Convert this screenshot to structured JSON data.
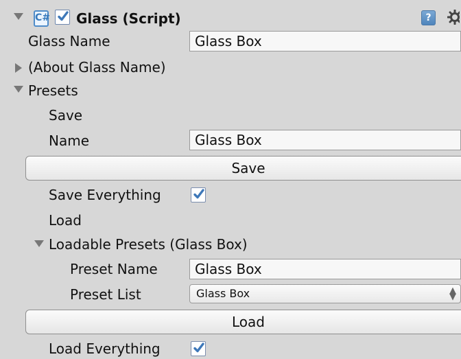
{
  "component": {
    "title": "Glass (Script)",
    "icons": {
      "script": "script-icon",
      "enabled": "checkbox-checked-icon",
      "help": "help-icon",
      "settings": "gear-icon"
    },
    "script_icon_text": "C#",
    "help_icon_text": "?"
  },
  "fields": {
    "glass_name_label": "Glass Name",
    "glass_name_value": "Glass Box",
    "about_glass_name_label": "(About Glass Name)"
  },
  "presets": {
    "label": "Presets",
    "save_section_label": "Save",
    "name_label": "Name",
    "name_value": "Glass Box",
    "save_button": "Save",
    "save_everything_label": "Save Everything",
    "save_everything_checked": true,
    "load_section_label": "Load",
    "loadable_presets_label": "Loadable Presets (Glass Box)",
    "preset_name_label": "Preset Name",
    "preset_name_value": "Glass Box",
    "preset_list_label": "Preset List",
    "preset_list_value": "Glass Box",
    "load_button": "Load",
    "load_everything_label": "Load Everything",
    "load_everything_checked": true
  },
  "colors": {
    "background": "#d7d7d7",
    "field_background": "#f7f7f7",
    "checkbox_check": "#3e78b9",
    "script_icon_blue": "#4f8cc9",
    "help_icon_blue": "#4f85bc"
  }
}
